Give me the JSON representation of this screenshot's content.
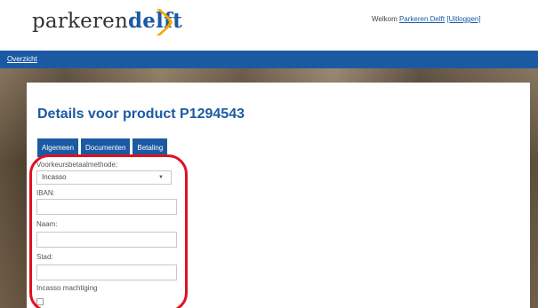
{
  "header": {
    "logo_part1": "parkeren",
    "logo_part2": "delft",
    "welcome_prefix": "Welkom ",
    "user_link": "Parkeren Delft",
    "logout_link": "[Uitloggen]"
  },
  "nav": {
    "overview": "Overzicht"
  },
  "page": {
    "title": "Details voor product P1294543"
  },
  "tabs": [
    {
      "label": "Algemeen"
    },
    {
      "label": "Documenten"
    },
    {
      "label": "Betaling"
    }
  ],
  "form": {
    "method_label": "Voorkeursbetaalmethode:",
    "method_value": "Incasso",
    "iban_label": "IBAN:",
    "iban_value": "",
    "name_label": "Naam:",
    "name_value": "",
    "city_label": "Stad:",
    "city_value": "",
    "mandate_label": "Incasso machtiging",
    "mandate_checked": false
  },
  "colors": {
    "brand_blue": "#1b5aa3",
    "logo_accent": "#f5a800",
    "annotation_red": "#e01020"
  },
  "icons": {
    "logo_mark": "chevron-right",
    "select_caret": "triangle-down"
  }
}
